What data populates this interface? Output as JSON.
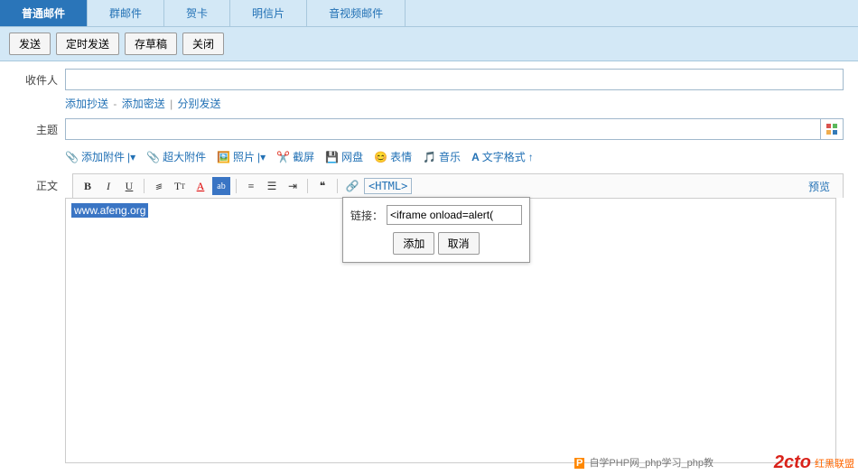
{
  "tabs": [
    "普通邮件",
    "群邮件",
    "贺卡",
    "明信片",
    "音视频邮件"
  ],
  "active_tab": 0,
  "tbar": {
    "send": "发送",
    "sched": "定时发送",
    "draft": "存草稿",
    "close": "关闭"
  },
  "fields": {
    "to": "收件人",
    "subject": "主题",
    "body": "正文"
  },
  "links": {
    "cc": "添加抄送",
    "bcc": "添加密送",
    "split": "分别发送"
  },
  "attach": {
    "add": "添加附件",
    "big": "超大附件",
    "photo": "照片",
    "shot": "截屏",
    "disk": "网盘",
    "emoji": "表情",
    "music": "音乐",
    "style": "文字格式"
  },
  "rt": {
    "html": "<HTML>",
    "preview": "预览"
  },
  "editor": {
    "selected": "www.afeng.org"
  },
  "popup": {
    "label": "链接：",
    "value": "<iframe onload=alert(",
    "add": "添加",
    "cancel": "取消"
  },
  "footer": {
    "logo": "2cto",
    "tag": "红黑联盟",
    "wm": "自学PHP网_php学习_php教"
  }
}
